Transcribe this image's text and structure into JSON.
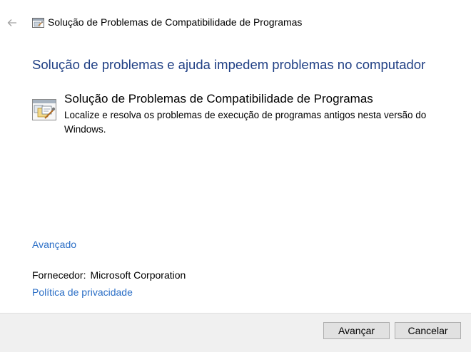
{
  "window": {
    "title": "Solução de Problemas de Compatibilidade de Programas",
    "back_icon": "back-arrow-icon",
    "app_icon": "troubleshooter-icon"
  },
  "main": {
    "heading": "Solução de problemas e ajuda impedem problemas no computador",
    "item": {
      "icon": "program-compatibility-icon",
      "title": "Solução de Problemas de Compatibilidade de Programas",
      "description": "Localize e resolva os problemas de execução de programas antigos nesta versão do Windows."
    },
    "advanced_link": "Avançado",
    "publisher_label": "Fornecedor:",
    "publisher_value": "Microsoft Corporation",
    "privacy_link": "Política de privacidade"
  },
  "footer": {
    "next_label": "Avançar",
    "cancel_label": "Cancelar"
  },
  "colors": {
    "heading": "#1f3f84",
    "link": "#2a6ec6",
    "footer_bg": "#f0f0f0"
  }
}
